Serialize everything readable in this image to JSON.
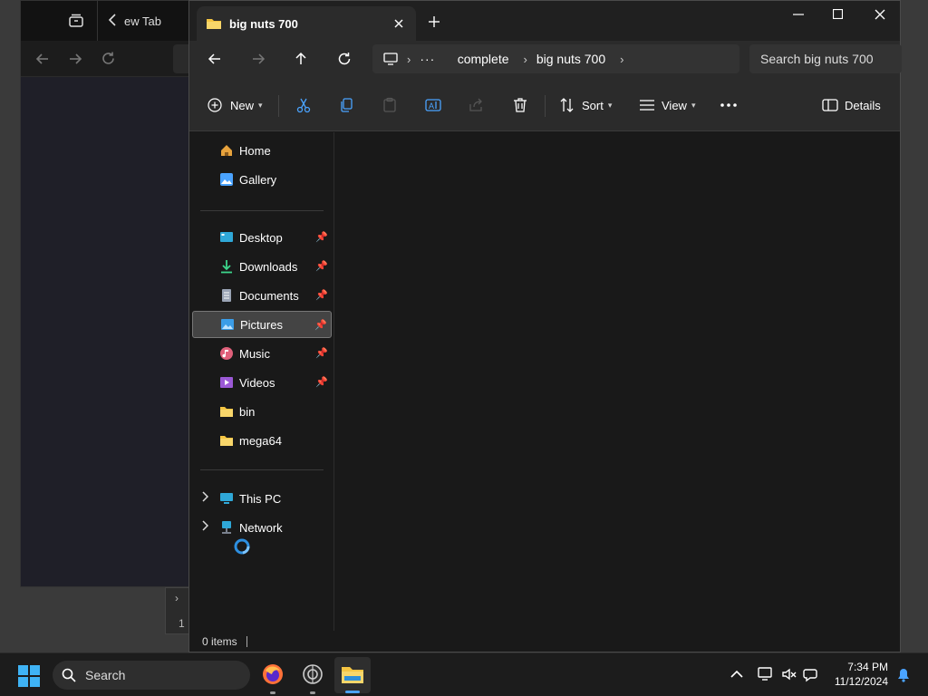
{
  "browser": {
    "tab_label": "ew Tab",
    "status_row": "1"
  },
  "explorer": {
    "tab_title": "big nuts 700",
    "breadcrumb": [
      "complete",
      "big nuts 700"
    ],
    "search_placeholder": "Search big nuts 700",
    "toolbar": {
      "new_label": "New",
      "sort_label": "Sort",
      "view_label": "View",
      "details_label": "Details"
    },
    "nav": {
      "home": "Home",
      "gallery": "Gallery",
      "desktop": "Desktop",
      "downloads": "Downloads",
      "documents": "Documents",
      "pictures": "Pictures",
      "music": "Music",
      "videos": "Videos",
      "bin": "bin",
      "mega64": "mega64",
      "this_pc": "This PC",
      "network": "Network"
    },
    "status": "0 items"
  },
  "taskbar": {
    "search_label": "Search",
    "time": "7:34 PM",
    "date": "11/12/2024"
  },
  "colors": {
    "accent": "#0078d4",
    "folder": "#f5c542"
  }
}
